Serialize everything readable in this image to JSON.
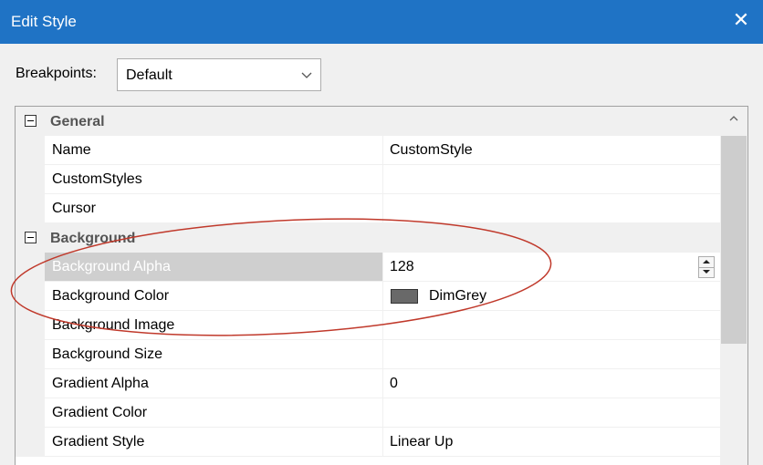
{
  "window": {
    "title": "Edit Style",
    "close_glyph": "✕"
  },
  "breakpoints": {
    "label": "Breakpoints:",
    "value": "Default"
  },
  "grid": {
    "categories": [
      {
        "name": "General",
        "items": [
          {
            "name": "Name",
            "value": "CustomStyle"
          },
          {
            "name": "CustomStyles",
            "value": ""
          },
          {
            "name": "Cursor",
            "value": ""
          }
        ]
      },
      {
        "name": "Background",
        "items": [
          {
            "name": "Background Alpha",
            "value": "128"
          },
          {
            "name": "Background Color",
            "value": "DimGrey",
            "swatch": "#696969"
          },
          {
            "name": "Background Image",
            "value": ""
          },
          {
            "name": "Background Size",
            "value": ""
          },
          {
            "name": "Gradient Alpha",
            "value": "0"
          },
          {
            "name": "Gradient Color",
            "value": ""
          },
          {
            "name": "Gradient Style",
            "value": "Linear Up"
          }
        ]
      }
    ]
  },
  "colors": {
    "titlebar": "#1f73c5",
    "annotation": "#c0392b"
  }
}
